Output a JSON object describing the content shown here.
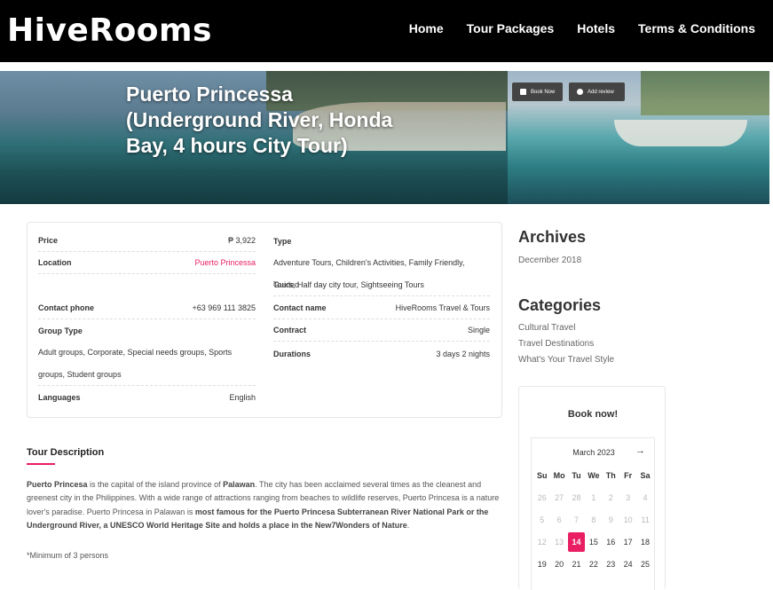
{
  "brand": {
    "logo": "HiveRooms"
  },
  "nav": [
    "Home",
    "Tour Packages",
    "Hotels",
    "Terms & Conditions"
  ],
  "hero": {
    "title": "Puerto Princessa (Underground River, Honda Bay, 4 hours City Tour)",
    "book_now": "Book Now",
    "add_review": "Add review",
    "price_peek": "₱ 3,922"
  },
  "info": {
    "price_label": "Price",
    "price_value": "₱ 3,922",
    "location_label": "Location",
    "location_value": "Puerto Princessa",
    "contact_phone_label": "Contact phone",
    "contact_phone_value": "+63 969 111 3825",
    "group_type_label": "Group Type",
    "group_type_line1": "Adult groups, Corporate, Special needs groups, Sports",
    "group_type_line2": "groups, Student groups",
    "languages_label": "Languages",
    "languages_value": "English",
    "type_label": "Type",
    "type_line1": "Adventure Tours, Children's Activities, Family Friendly, Guided",
    "type_line2": "Tours, Half day city tour, Sightseeing Tours",
    "contact_name_label": "Contact name",
    "contact_name_value": "HiveRooms Travel & Tours",
    "contract_label": "Contract",
    "contract_value": "Single",
    "durations_label": "Durations",
    "durations_value": "3 days 2 nights"
  },
  "description": {
    "title": "Tour Description",
    "p1": "Puerto Princesa",
    "p2": " is the capital of the island province of ",
    "p3": "Palawan",
    "p4": ". The city has been acclaimed several times as the cleanest and greenest city in the Philippines. With a wide range of attractions ranging from beaches to wildlife reserves, Puerto Princesa is a nature lover's paradise. Puerto Princesa in Palawan is ",
    "p5": "most famous for the Puerto Princesa Subterranean River National Park or the Underground River, a UNESCO World Heritage Site and holds a place in the New7Wonders of Nature",
    "p6": ".",
    "note": "*Minimum of 3 persons"
  },
  "sidebar": {
    "archives_title": "Archives",
    "archives": [
      "December 2018"
    ],
    "categories_title": "Categories",
    "categories": [
      "Cultural Travel",
      "Travel Destinations",
      "What's Your Travel Style"
    ],
    "book_now": "Book now!",
    "calendar": {
      "month": "March 2023",
      "next_icon": "→",
      "days": [
        "Su",
        "Mo",
        "Tu",
        "We",
        "Th",
        "Fr",
        "Sa"
      ],
      "row1": [
        "26",
        "27",
        "28",
        "1",
        "2",
        "3",
        "4"
      ],
      "row2": [
        "5",
        "6",
        "7",
        "8",
        "9",
        "10",
        "11"
      ],
      "row3": [
        "12",
        "13",
        "14",
        "15",
        "16",
        "17",
        "18"
      ],
      "row4": [
        "19",
        "20",
        "21",
        "22",
        "23",
        "24",
        "25"
      ],
      "today": "14"
    }
  },
  "colors": {
    "accent": "#e91e63",
    "header_bg": "#000000"
  }
}
